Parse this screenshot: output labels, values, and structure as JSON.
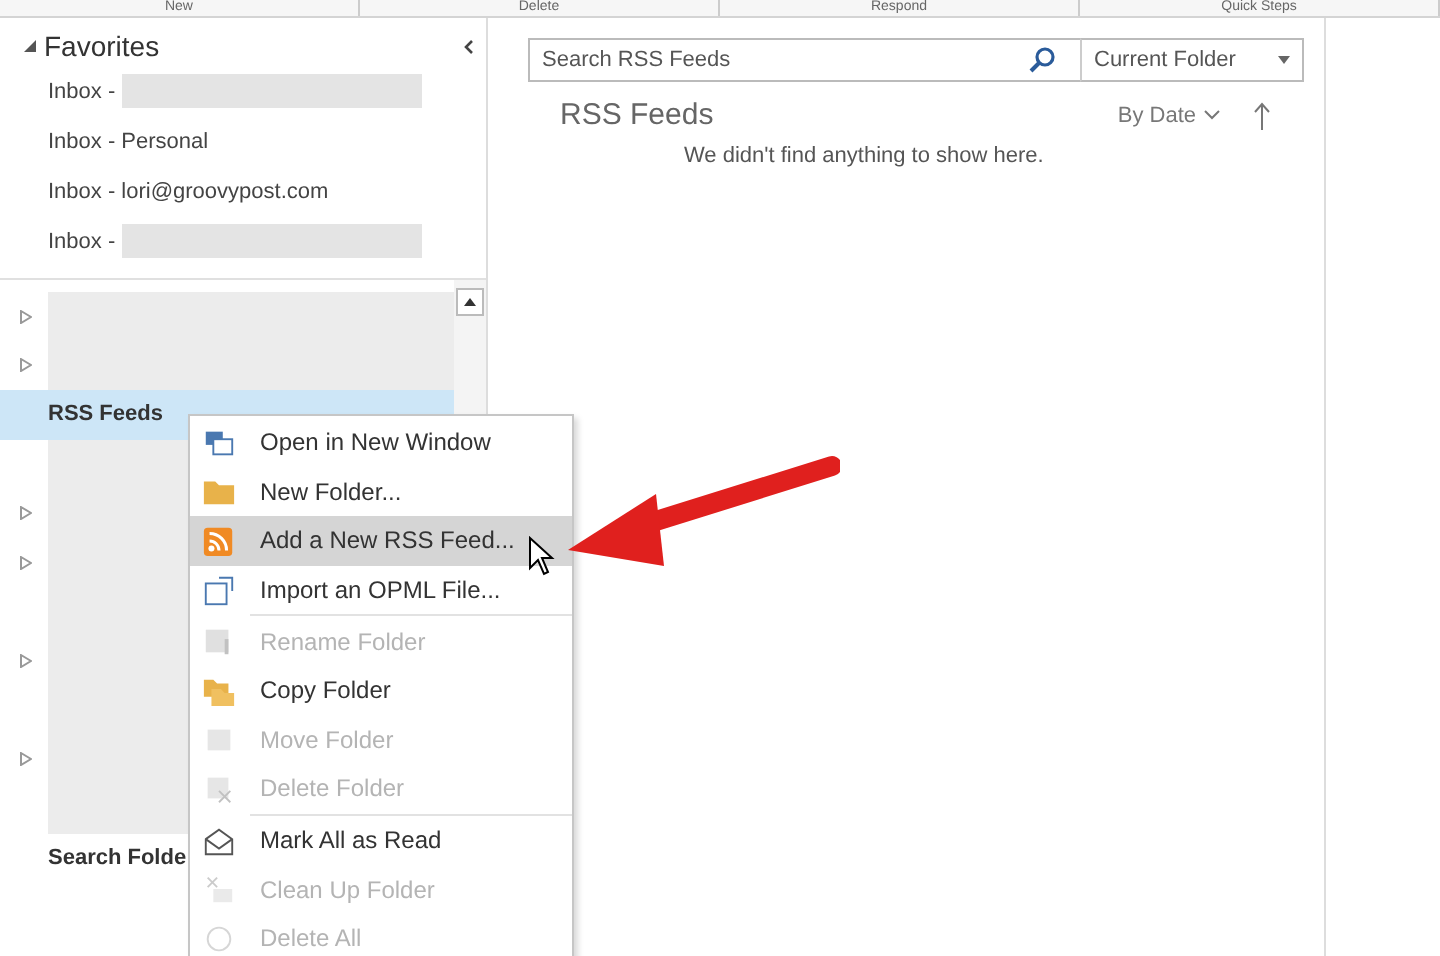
{
  "ribbon": {
    "groups": [
      "New",
      "Delete",
      "Respond",
      "Quick Steps"
    ]
  },
  "favorites": {
    "title": "Favorites",
    "expanded": true,
    "items": [
      {
        "label": "Inbox -",
        "redacted": true
      },
      {
        "label": "Inbox - Personal",
        "redacted": false
      },
      {
        "label": "Inbox - lori@groovypost.com",
        "redacted": false
      },
      {
        "label": "Inbox -",
        "redacted": true
      }
    ]
  },
  "folders": [
    {
      "kind": "redacted",
      "expandable": true,
      "selected": false
    },
    {
      "kind": "redacted",
      "expandable": true,
      "selected": false
    },
    {
      "kind": "folder",
      "label": "RSS Feeds",
      "expandable": false,
      "selected": true
    },
    {
      "kind": "redacted",
      "expandable": false,
      "selected": false
    },
    {
      "kind": "redacted",
      "expandable": true,
      "selected": false
    },
    {
      "kind": "redacted",
      "expandable": true,
      "selected": false
    },
    {
      "kind": "redacted",
      "expandable": false,
      "selected": false
    },
    {
      "kind": "redacted",
      "expandable": true,
      "selected": false
    },
    {
      "kind": "redacted",
      "expandable": false,
      "selected": false
    },
    {
      "kind": "redacted",
      "expandable": true,
      "selected": false
    },
    {
      "kind": "redacted",
      "expandable": false,
      "selected": false
    },
    {
      "kind": "folder",
      "label": "Search Folde",
      "expandable": false,
      "selected": false
    }
  ],
  "search": {
    "placeholder": "Search RSS Feeds",
    "scope": "Current Folder"
  },
  "list": {
    "title": "RSS Feeds",
    "sort": "By Date",
    "empty_message": "We didn't find anything to show here."
  },
  "context_menu": [
    {
      "kind": "item",
      "label": "Open in New Window",
      "disabled": false,
      "selected": false
    },
    {
      "kind": "item",
      "label": "New Folder...",
      "disabled": false,
      "selected": false
    },
    {
      "kind": "item",
      "label": "Add a New RSS Feed...",
      "disabled": false,
      "selected": true
    },
    {
      "kind": "item",
      "label": "Import an OPML File...",
      "disabled": false,
      "selected": false
    },
    {
      "kind": "separator"
    },
    {
      "kind": "item",
      "label": "Rename Folder",
      "disabled": true,
      "selected": false
    },
    {
      "kind": "item",
      "label": "Copy Folder",
      "disabled": false,
      "selected": false
    },
    {
      "kind": "item",
      "label": "Move Folder",
      "disabled": true,
      "selected": false
    },
    {
      "kind": "item",
      "label": "Delete Folder",
      "disabled": true,
      "selected": false
    },
    {
      "kind": "separator"
    },
    {
      "kind": "item",
      "label": "Mark All as Read",
      "disabled": false,
      "selected": false
    },
    {
      "kind": "item",
      "label": "Clean Up Folder",
      "disabled": true,
      "selected": false
    },
    {
      "kind": "item",
      "label": "Delete All",
      "disabled": true,
      "selected": false
    }
  ]
}
